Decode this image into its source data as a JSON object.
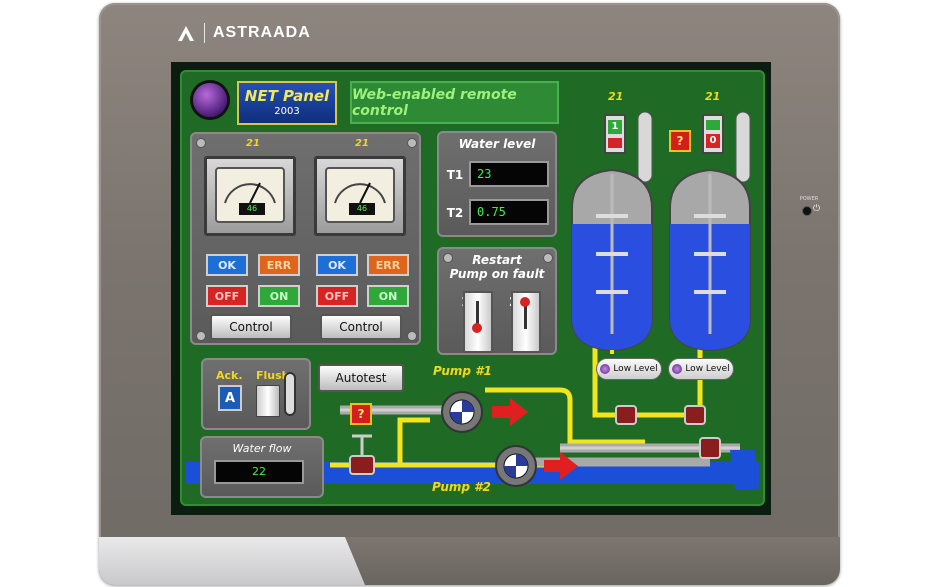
{
  "brand": {
    "name": "ASTRAADA"
  },
  "device": {
    "power_label": "POWER"
  },
  "header": {
    "title": "NET Panel",
    "year": "2003",
    "subtitle": "Web-enabled remote control"
  },
  "gauges": [
    {
      "top_label": "21",
      "reading": "46",
      "ok_label": "OK",
      "err_label": "ERR",
      "off_label": "OFF",
      "on_label": "ON",
      "control_label": "Control"
    },
    {
      "top_label": "21",
      "reading": "46",
      "ok_label": "OK",
      "err_label": "ERR",
      "off_label": "OFF",
      "on_label": "ON",
      "control_label": "Control"
    }
  ],
  "water_level": {
    "title": "Water level",
    "rows": [
      {
        "label": "T1",
        "value": "23"
      },
      {
        "label": "T2",
        "value": "0.75"
      }
    ]
  },
  "restart": {
    "title_line1": "Restart",
    "title_line2": "Pump on fault",
    "switch1": "1",
    "switch2": "2"
  },
  "ack_panel": {
    "ack_label": "Ack.",
    "flush_label": "Flush",
    "a_button": "A"
  },
  "autotest_label": "Autotest",
  "water_flow": {
    "title": "Water flow",
    "value": "22"
  },
  "pumps": [
    {
      "label": "Pump #1"
    },
    {
      "label": "Pump #2"
    }
  ],
  "tanks": [
    {
      "top_label": "21",
      "indicator": "1",
      "low_level_label": "Low Level"
    },
    {
      "top_label": "21",
      "indicator": "0",
      "low_level_label": "Low Level"
    }
  ],
  "alarm_symbol": "?",
  "colors": {
    "screen_green": "#1f6a24",
    "pipe_yellow": "#f2e51e",
    "water_blue": "#1c4fd8",
    "bezel": "#7b746e"
  }
}
